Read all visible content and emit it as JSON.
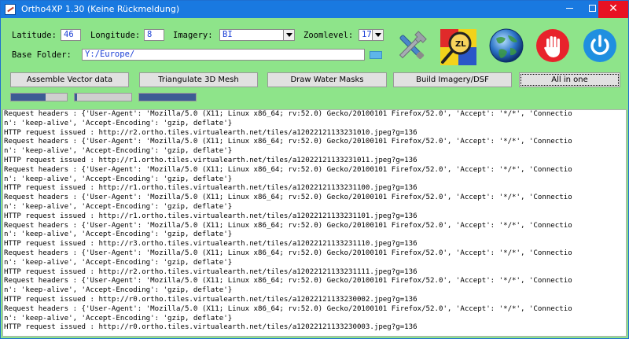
{
  "window": {
    "title": "Ortho4XP 1.30 (Keine Rückmeldung)",
    "minimize": "—",
    "close": "✕"
  },
  "form": {
    "latitude_label": "Latitude:",
    "latitude_value": "46",
    "longitude_label": "Longitude:",
    "longitude_value": "8",
    "imagery_label": "Imagery:",
    "imagery_value": "BI",
    "zoomlevel_label": "Zoomlevel:",
    "zoomlevel_value": "17",
    "base_folder_label": "Base Folder:",
    "base_folder_value": "Y:/Europe/"
  },
  "buttons": {
    "assemble": "Assemble Vector data",
    "triangulate": "Triangulate 3D Mesh",
    "water": "Draw Water Masks",
    "imagery": "Build Imagery/DSF",
    "all": "All in one"
  },
  "icons": {
    "tools": "tools-icon",
    "zl": "zoomlevel-icon",
    "zl_text": "ZL",
    "globe": "globe-icon",
    "stop": "stop-hand-icon",
    "power": "power-icon"
  },
  "progress": {
    "bar1": 0.62,
    "bar2": 0.04,
    "bar3": 1.0
  },
  "log_lines": [
    "Request headers : {'User-Agent': 'Mozilla/5.0 (X11; Linux x86_64; rv:52.0) Gecko/20100101 Firefox/52.0', 'Accept': '*/*', 'Connectio",
    "n': 'keep-alive', 'Accept-Encoding': 'gzip, deflate'}",
    "HTTP request issued : http://r2.ortho.tiles.virtualearth.net/tiles/a1202212113323101 0.jpeg?g=136",
    "Request headers : {'User-Agent': 'Mozilla/5.0 (X11; Linux x86_64; rv:52.0) Gecko/20100101 Firefox/52.0', 'Accept': '*/*', 'Connectio",
    "n': 'keep-alive', 'Accept-Encoding': 'gzip, deflate'}",
    "HTTP request issued : http://r1.ortho.tiles.virtualearth.net/tiles/a12022121133231011.jpeg?g=136",
    "Request headers : {'User-Agent': 'Mozilla/5.0 (X11; Linux x86_64; rv:52.0) Gecko/20100101 Firefox/52.0', 'Accept': '*/*', 'Connectio",
    "n': 'keep-alive', 'Accept-Encoding': 'gzip, deflate'}",
    "HTTP request issued : http://r1.ortho.tiles.virtualearth.net/tiles/a12022121133231100.jpeg?g=136",
    "Request headers : {'User-Agent': 'Mozilla/5.0 (X11; Linux x86_64; rv:52.0) Gecko/20100101 Firefox/52.0', 'Accept': '*/*', 'Connectio",
    "n': 'keep-alive', 'Accept-Encoding': 'gzip, deflate'}",
    "HTTP request issued : http://r1.ortho.tiles.virtualearth.net/tiles/a12022121133231101.jpeg?g=136",
    "Request headers : {'User-Agent': 'Mozilla/5.0 (X11; Linux x86_64; rv:52.0) Gecko/20100101 Firefox/52.0', 'Accept': '*/*', 'Connectio",
    "n': 'keep-alive', 'Accept-Encoding': 'gzip, deflate'}",
    "HTTP request issued : http://r3.ortho.tiles.virtualearth.net/tiles/a12022121133231110.jpeg?g=136",
    "Request headers : {'User-Agent': 'Mozilla/5.0 (X11; Linux x86_64; rv:52.0) Gecko/20100101 Firefox/52.0', 'Accept': '*/*', 'Connectio",
    "n': 'keep-alive', 'Accept-Encoding': 'gzip, deflate'}",
    "HTTP request issued : http://r2.ortho.tiles.virtualearth.net/tiles/a12022121133231111.jpeg?g=136",
    "Request headers : {'User-Agent': 'Mozilla/5.0 (X11; Linux x86_64; rv:52.0) Gecko/20100101 Firefox/52.0', 'Accept': '*/*', 'Connectio",
    "n': 'keep-alive', 'Accept-Encoding': 'gzip, deflate'}",
    "HTTP request issued : http://r0.ortho.tiles.virtualearth.net/tiles/a12022121133230002.jpeg?g=136",
    "Request headers : {'User-Agent': 'Mozilla/5.0 (X11; Linux x86_64; rv:52.0) Gecko/20100101 Firefox/52.0', 'Accept': '*/*', 'Connectio",
    "n': 'keep-alive', 'Accept-Encoding': 'gzip, deflate'}",
    "HTTP request issued : http://r0.ortho.tiles.virtualearth.net/tiles/a12022121133230003.jpeg?g=136"
  ]
}
